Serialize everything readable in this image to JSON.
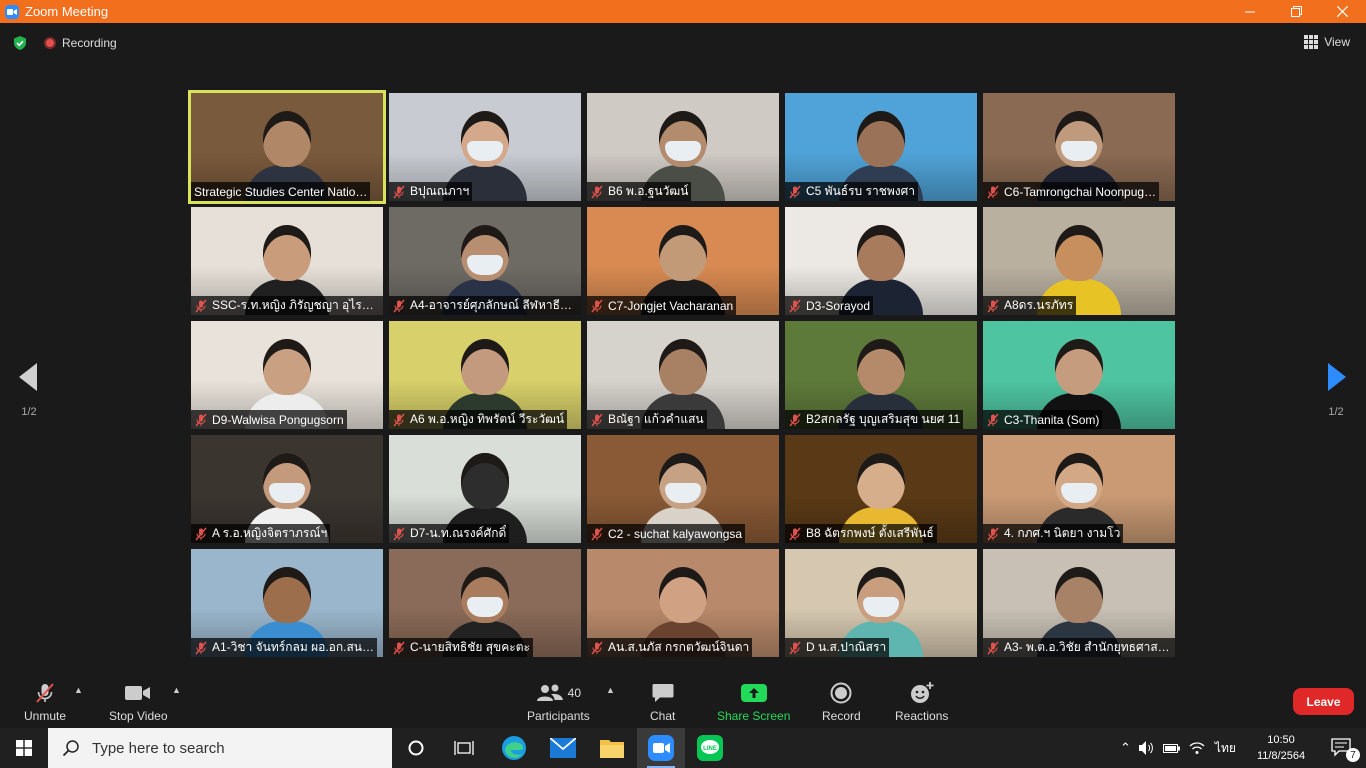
{
  "window": {
    "title": "Zoom Meeting"
  },
  "status": {
    "recording": "Recording",
    "view": "View"
  },
  "pager": {
    "left": "1/2",
    "right": "1/2"
  },
  "participants": [
    {
      "name": "Strategic Studies Center Natio…",
      "muted": false,
      "active": true,
      "bg": "#7a5a3c",
      "skin": "#b08868",
      "shirt": "#2d3340",
      "mask": false
    },
    {
      "name": "Bปุณณภาฯ",
      "muted": true,
      "bg": "#c8ccd2",
      "skin": "#d4a88a",
      "shirt": "#2b2f3a",
      "mask": true
    },
    {
      "name": "B6 พ.อ.ฐนวัฒน์",
      "muted": true,
      "bg": "#cfcac4",
      "skin": "#b38b6d",
      "shirt": "#4a4e46",
      "mask": true
    },
    {
      "name": "C5 พันธ์รบ ราชพงศา",
      "muted": true,
      "bg": "#4fa3d8",
      "skin": "#9a7257",
      "shirt": "#2e3d52",
      "mask": false
    },
    {
      "name": "C6-Tamrongchai Noonpug…",
      "muted": true,
      "bg": "#8a6a52",
      "skin": "#c09a7c",
      "shirt": "#1e2230",
      "mask": true
    },
    {
      "name": "SSC-ร.ท.หญิง ภิรัญชญา อุไรรัตน์",
      "muted": true,
      "bg": "#e6e0d8",
      "skin": "#c99c7c",
      "shirt": "#202020",
      "mask": false
    },
    {
      "name": "A4-อาจารย์ศุภลักษณ์ ลีฬหาธีร…",
      "muted": true,
      "bg": "#6e6a64",
      "skin": "#b88e70",
      "shirt": "#2a3248",
      "mask": true
    },
    {
      "name": "C7-Jongjet Vacharanan",
      "muted": true,
      "bg": "#d88a52",
      "skin": "#c29a78",
      "shirt": "#1c1c1c",
      "mask": false
    },
    {
      "name": "D3-Sorayod",
      "muted": true,
      "bg": "#ece9e4",
      "skin": "#a77b5c",
      "shirt": "#1c2434",
      "mask": false
    },
    {
      "name": "A8ดร.นรภัทร",
      "muted": true,
      "bg": "#b9b0a0",
      "skin": "#c78e5e",
      "shirt": "#e8c326",
      "mask": false
    },
    {
      "name": "D9-Walwisa Pongugsorn",
      "muted": true,
      "bg": "#e8e2da",
      "skin": "#caa082",
      "shirt": "#ededed",
      "mask": false
    },
    {
      "name": "A6 พ.อ.หญิง ทิพรัตน์ วีระวัฒน์",
      "muted": true,
      "bg": "#d8d06a",
      "skin": "#c39a7e",
      "shirt": "#2b3a2c",
      "mask": false
    },
    {
      "name": "Bณัฐา แก้วคำแสน",
      "muted": true,
      "bg": "#d6d2cc",
      "skin": "#a88064",
      "shirt": "#3a3a3a",
      "mask": false
    },
    {
      "name": "B2สกลรัฐ บุญเสริมสุข นยศ 11",
      "muted": true,
      "bg": "#5e7a3a",
      "skin": "#b48a6a",
      "shirt": "#27303a",
      "mask": false
    },
    {
      "name": "C3-Thanita (Som)",
      "muted": true,
      "bg": "#4ec4a0",
      "skin": "#c59c7e",
      "shirt": "#111111",
      "mask": false
    },
    {
      "name": "A ร.อ.หญิงจิตราภรณ์ฯ",
      "muted": true,
      "bg": "#3b3530",
      "skin": "#c49a7c",
      "shirt": "#efefef",
      "mask": true
    },
    {
      "name": "D7-น.ท.ณรงค์ศักดิ์",
      "muted": true,
      "bg": "#d9ded8",
      "skin": "#2d2d2d",
      "shirt": "#1e1e1e",
      "mask": false
    },
    {
      "name": "C2 - suchat kalyawongsa",
      "muted": true,
      "bg": "#8a5a36",
      "skin": "#c7a184",
      "shirt": "#d8d2c8",
      "mask": true
    },
    {
      "name": "B8 ฉัตรกพงษ์ ตั้งเสรีพันธ์",
      "muted": true,
      "bg": "#5a3a16",
      "skin": "#d6ae8c",
      "shirt": "#e8b830",
      "mask": false
    },
    {
      "name": "4. กภศ.ฯ นิตยา งามโว",
      "muted": true,
      "bg": "#c99a74",
      "skin": "#d2a886",
      "shirt": "#2a2a2a",
      "mask": true
    },
    {
      "name": "A1-วิชา  จันทร์กลม ผอ.อก.สน…",
      "muted": true,
      "bg": "#9ab6cc",
      "skin": "#9c6e4c",
      "shirt": "#3a8ed0",
      "mask": false
    },
    {
      "name": "C-นายสิทธิชัย สุขคะตะ",
      "muted": true,
      "bg": "#8a6a58",
      "skin": "#a97c5e",
      "shirt": "#222222",
      "mask": true
    },
    {
      "name": "Aน.ส.นภัส กรกตวัฒน์จินดา",
      "muted": true,
      "bg": "#b8896a",
      "skin": "#d1a184",
      "shirt": "#6a4230",
      "mask": false
    },
    {
      "name": "D น.ส.ปาณิสรา",
      "muted": true,
      "bg": "#d6c8b0",
      "skin": "#c99e7e",
      "shirt": "#5fb6b0",
      "mask": true
    },
    {
      "name": "A3- พ.ต.อ.วิชัย สำนักยุทธศาสต…",
      "muted": true,
      "bg": "#c8c0b4",
      "skin": "#a88266",
      "shirt": "#2c3542",
      "mask": false
    }
  ],
  "toolbar": {
    "unmute": "Unmute",
    "stop_video": "Stop Video",
    "participants": "Participants",
    "participants_count": "40",
    "chat": "Chat",
    "share_screen": "Share Screen",
    "record": "Record",
    "reactions": "Reactions",
    "leave": "Leave"
  },
  "taskbar": {
    "search_placeholder": "Type here to search",
    "language": "ไทย",
    "time": "10:50",
    "date": "11/8/2564",
    "notifications": "7"
  },
  "colors": {
    "zoom_orange": "#f26f1e",
    "active_speaker": "#d8e25a",
    "leave_red": "#e02828",
    "share_green": "#23d959"
  }
}
